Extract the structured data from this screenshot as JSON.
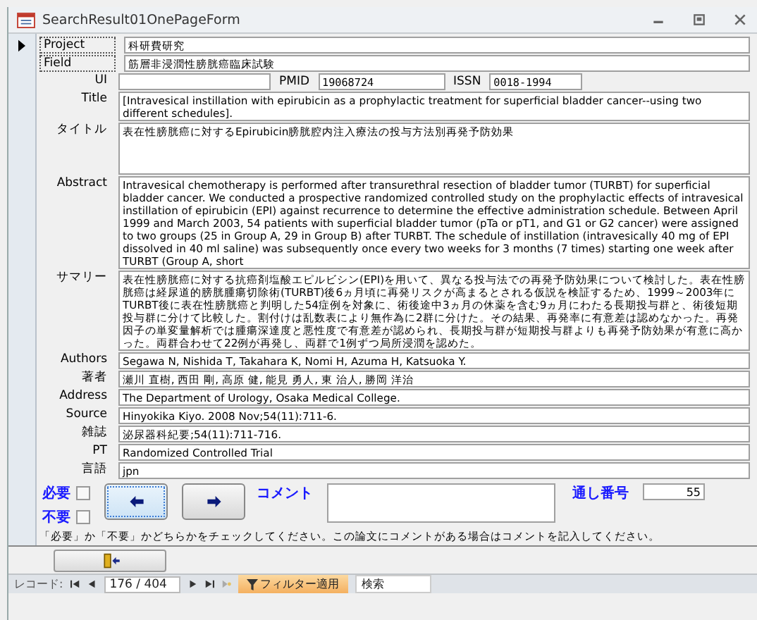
{
  "window": {
    "title": "SearchResult01OnePageForm"
  },
  "fields": [
    {
      "kind": "line",
      "label": "Project",
      "value": "科研費研究"
    },
    {
      "kind": "line",
      "label": "Field",
      "value": "筋層非浸潤性膀胱癌臨床試験"
    },
    {
      "kind": "ids",
      "label": "UI",
      "pmid_label": "PMID",
      "pmid": "19068724",
      "issn_label": "ISSN",
      "issn": "0018-1994"
    },
    {
      "kind": "multi",
      "label": "Title",
      "value": "[Intravesical instillation with epirubicin as a prophylactic treatment for superficial bladder cancer--using two different schedules]."
    },
    {
      "kind": "tall",
      "label": "タイトル",
      "value": "表在性膀胱癌に対するEpirubicin膀胱腔内注入療法の投与方法別再発予防効果"
    },
    {
      "kind": "multi",
      "label": "Abstract",
      "value": "Intravesical chemotherapy is performed after transurethral resection of bladder tumor (TURBT) for superficial bladder cancer. We conducted a prospective randomized controlled study on the prophylactic effects of intravesical instillation of epirubicin (EPI) against recurrence to determine the effective administration schedule. Between April 1999 and March 2003, 54 patients with superficial bladder tumor (pTa or pT1, and G1 or G2 cancer) were assigned to two  groups (25 in Group A, 29 in Group B) after TURBT. The schedule of instillation (intravesically 40 mg of EPI dissolved in 40 ml saline) was subsequently once every two weeks for 3 months (7 times) starting one week after TURBT (Group A, short"
    },
    {
      "kind": "multi",
      "label": "サマリー",
      "value": "表在性膀胱癌に対する抗癌剤塩酸エピルビシン(EPI)を用いて、異なる投与法での再発予防効果について検討した。表在性膀胱癌は経尿道的膀胱腫瘍切除術(TURBT)後6ヵ月頃に再発リスクが高まるとされる仮説を検証するため、1999～2003年にTURBT後に表在性膀胱癌と判明した54症例を対象に、術後途中3ヵ月の休薬を含む9ヵ月にわたる長期投与群と、術後短期投与群に分けて比較した。割付けは乱数表により無作為に2群に分けた。その結果、再発率に有意差は認めなかった。再発因子の単変量解析では腫瘍深達度と悪性度で有意差が認められ、長期投与群が短期投与群よりも再発予防効果が有意に高かった。両群合わせて22例が再発し、両群で1例ずつ局所浸潤を認めた。"
    },
    {
      "kind": "line",
      "label": "Authors",
      "value": "Segawa N, Nishida T, Takahara K, Nomi H, Azuma H, Katsuoka Y."
    },
    {
      "kind": "line",
      "label": "著者",
      "value": "瀬川 直樹, 西田 剛, 高原 健, 能見 勇人, 東 治人, 勝岡 洋治"
    },
    {
      "kind": "line",
      "label": "Address",
      "value": "The Department of Urology, Osaka Medical College."
    },
    {
      "kind": "line",
      "label": "Source",
      "value": "Hinyokika Kiyo. 2008 Nov;54(11):711-6."
    },
    {
      "kind": "line",
      "label": "雑誌",
      "value": "泌尿器科紀要;54(11):711-716."
    },
    {
      "kind": "line",
      "label": "PT",
      "value": "Randomized Controlled Trial"
    },
    {
      "kind": "line",
      "label": "言語",
      "value": "jpn"
    }
  ],
  "checks": [
    {
      "label": "必要",
      "checked": false
    },
    {
      "label": "不要",
      "checked": false
    }
  ],
  "comment_label": "コメント",
  "serial_label": "通し番号",
  "serial": "55",
  "note": "「必要」か「不要」かどちらかをチェックしてください。この論文にコメントがある場合はコメントを記入してください。",
  "nav": {
    "label": "レコード:",
    "position": "176 / 404",
    "filter": "フィルター適用",
    "search": "検索"
  }
}
